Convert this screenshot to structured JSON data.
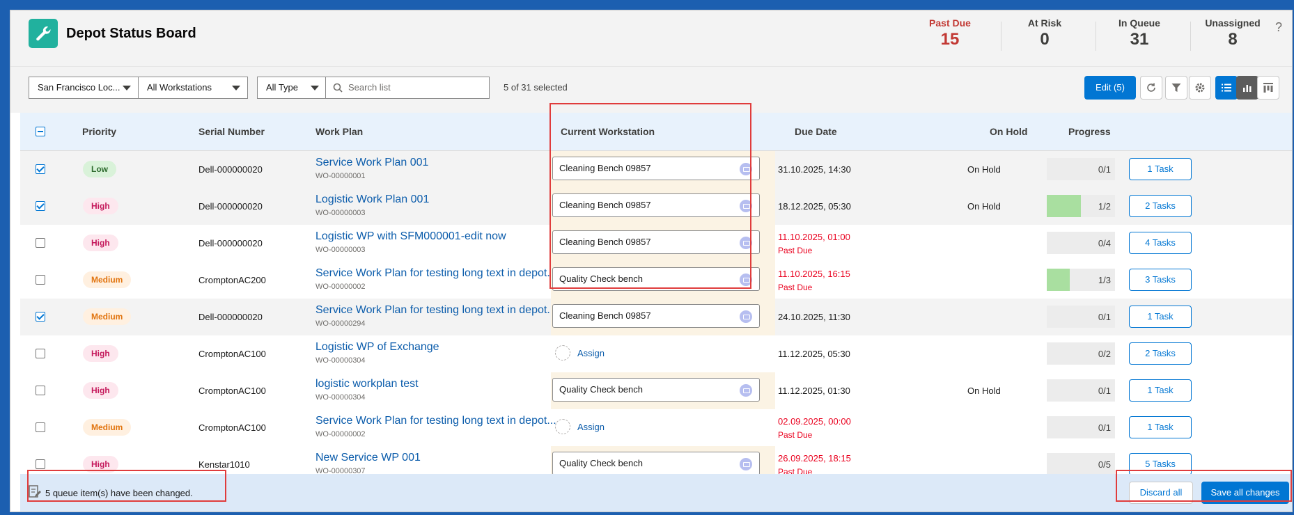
{
  "app": {
    "title": "Depot Status Board",
    "help_label": "?"
  },
  "kpis": [
    {
      "label": "Past Due",
      "value": "15",
      "color": "#c23934"
    },
    {
      "label": "At Risk",
      "value": "0"
    },
    {
      "label": "In Queue",
      "value": "31"
    },
    {
      "label": "Unassigned",
      "value": "8"
    }
  ],
  "toolbar": {
    "location": "San Francisco Loc...",
    "workstations": "All Workstations",
    "type": "All Type",
    "search_placeholder": "Search list",
    "selected_count": "5 of 31 selected",
    "edit_label": "Edit (5)",
    "icons": [
      "refresh-icon",
      "filter-icon",
      "settings-icon",
      "list-view-icon",
      "chart-view-icon",
      "kanban-view-icon"
    ]
  },
  "columns": [
    "Priority",
    "Serial Number",
    "Work Plan",
    "Current Workstation",
    "Due Date",
    "On Hold",
    "Progress"
  ],
  "rows": [
    {
      "checked": true,
      "priority": "Low",
      "serial": "Dell-000000020",
      "plan": "Service Work Plan 001",
      "wo": "WO-00000001",
      "workstation": "Cleaning Bench 09857",
      "due": "31.10.2025, 14:30",
      "past_due": "",
      "on_hold": "On Hold",
      "progress": "0/1",
      "progress_fraction": 0,
      "tasks": "1 Task"
    },
    {
      "checked": true,
      "priority": "High",
      "serial": "Dell-000000020",
      "plan": "Logistic Work Plan 001",
      "wo": "WO-00000003",
      "workstation": "Cleaning Bench 09857",
      "due": "18.12.2025, 05:30",
      "past_due": "",
      "on_hold": "On Hold",
      "progress": "1/2",
      "progress_fraction": 0.5,
      "tasks": "2 Tasks"
    },
    {
      "checked": false,
      "priority": "High",
      "serial": "Dell-000000020",
      "plan": "Logistic WP with SFM000001-edit now",
      "wo": "WO-00000003",
      "workstation": "Cleaning Bench 09857",
      "due": "11.10.2025, 01:00",
      "past_due": "Past Due",
      "on_hold": "",
      "progress": "0/4",
      "progress_fraction": 0,
      "tasks": "4 Tasks"
    },
    {
      "checked": false,
      "priority": "Medium",
      "serial": "CromptonAC200",
      "plan": "Service Work Plan for testing long text in depot...",
      "wo": "WO-00000002",
      "workstation": "Quality Check bench",
      "due": "11.10.2025, 16:15",
      "past_due": "Past Due",
      "on_hold": "",
      "progress": "1/3",
      "progress_fraction": 0.333,
      "tasks": "3 Tasks"
    },
    {
      "checked": true,
      "priority": "Medium",
      "serial": "Dell-000000020",
      "plan": "Service Work Plan for testing long text in depot...",
      "wo": "WO-00000294",
      "workstation": "Cleaning Bench 09857",
      "due": "24.10.2025, 11:30",
      "past_due": "",
      "on_hold": "",
      "progress": "0/1",
      "progress_fraction": 0,
      "tasks": "1 Task"
    },
    {
      "checked": false,
      "priority": "High",
      "serial": "CromptonAC100",
      "plan": "Logistic WP of Exchange",
      "wo": "WO-00000304",
      "workstation": "",
      "assign_label": "Assign",
      "due": "11.12.2025, 05:30",
      "past_due": "",
      "on_hold": "",
      "progress": "0/2",
      "progress_fraction": 0,
      "tasks": "2 Tasks"
    },
    {
      "checked": false,
      "priority": "High",
      "serial": "CromptonAC100",
      "plan": "logistic workplan test",
      "wo": "WO-00000304",
      "workstation": "Quality Check bench",
      "due": "11.12.2025, 01:30",
      "past_due": "",
      "on_hold": "On Hold",
      "progress": "0/1",
      "progress_fraction": 0,
      "tasks": "1 Task"
    },
    {
      "checked": false,
      "priority": "Medium",
      "serial": "CromptonAC100",
      "plan": "Service Work Plan for testing long text in depot...",
      "wo": "WO-00000002",
      "workstation": "",
      "assign_label": "Assign",
      "due": "02.09.2025, 00:00",
      "past_due": "Past Due",
      "on_hold": "",
      "progress": "0/1",
      "progress_fraction": 0,
      "tasks": "1 Task"
    },
    {
      "checked": false,
      "priority": "High",
      "serial": "Kenstar1010",
      "plan": "New Service WP 001",
      "wo": "WO-00000307",
      "workstation": "Quality Check bench",
      "due": "26.09.2025, 18:15",
      "past_due": "Past Due",
      "on_hold": "",
      "progress": "0/5",
      "progress_fraction": 0,
      "tasks": "5 Tasks"
    }
  ],
  "footer": {
    "message": "5 queue item(s) have been changed.",
    "discard_label": "Discard all",
    "save_label": "Save all changes"
  },
  "colors": {
    "accent": "#0176d3",
    "danger": "#ea001e",
    "app_icon": "#21b19e"
  }
}
